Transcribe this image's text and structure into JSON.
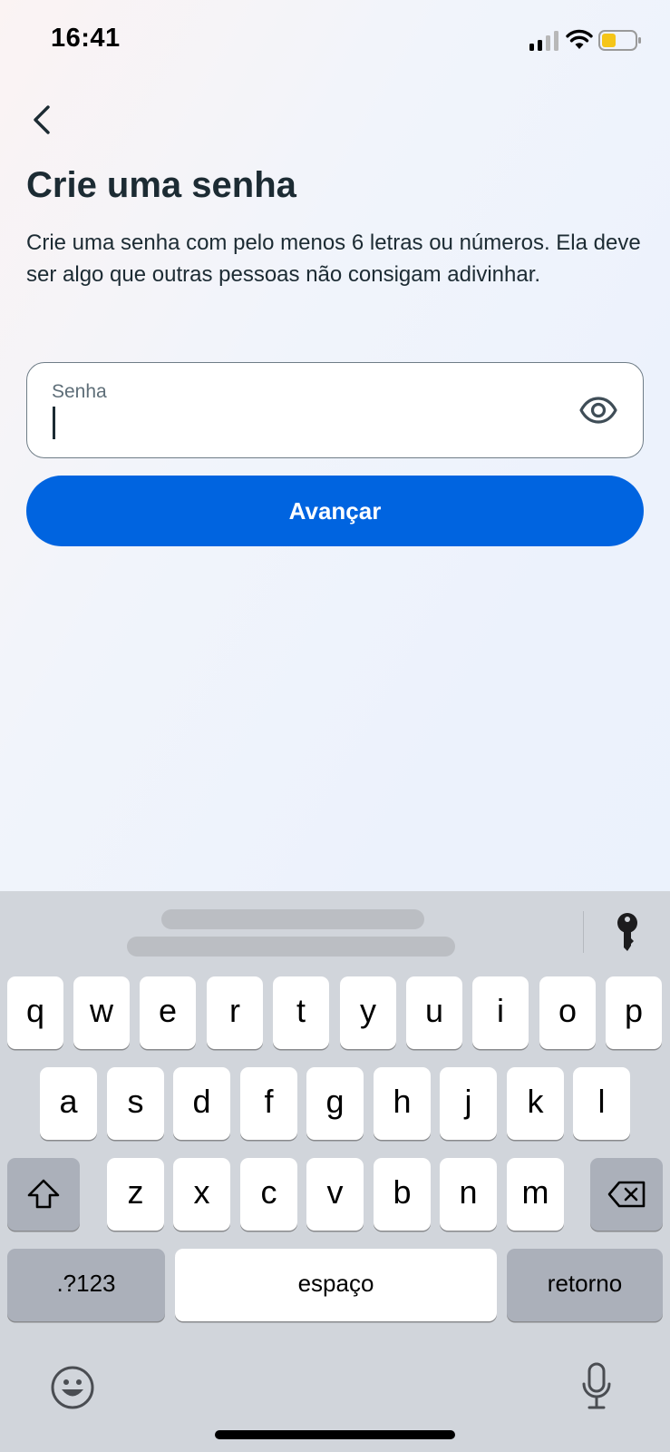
{
  "status_bar": {
    "time": "16:41"
  },
  "header": {
    "title": "Crie uma senha"
  },
  "description": "Crie uma senha com pelo menos 6 letras ou números. Ela deve ser algo que outras pessoas não consigam adivinhar.",
  "password_field": {
    "label": "Senha",
    "value": ""
  },
  "next_button": {
    "label": "Avançar"
  },
  "keyboard": {
    "row1": [
      "q",
      "w",
      "e",
      "r",
      "t",
      "y",
      "u",
      "i",
      "o",
      "p"
    ],
    "row2": [
      "a",
      "s",
      "d",
      "f",
      "g",
      "h",
      "j",
      "k",
      "l"
    ],
    "row3": [
      "z",
      "x",
      "c",
      "v",
      "b",
      "n",
      "m"
    ],
    "numbers_key": ".?123",
    "space_key": "espaço",
    "return_key": "retorno"
  },
  "colors": {
    "primary": "#0064e0",
    "text": "#1c2b33",
    "battery": "#f5c518"
  }
}
